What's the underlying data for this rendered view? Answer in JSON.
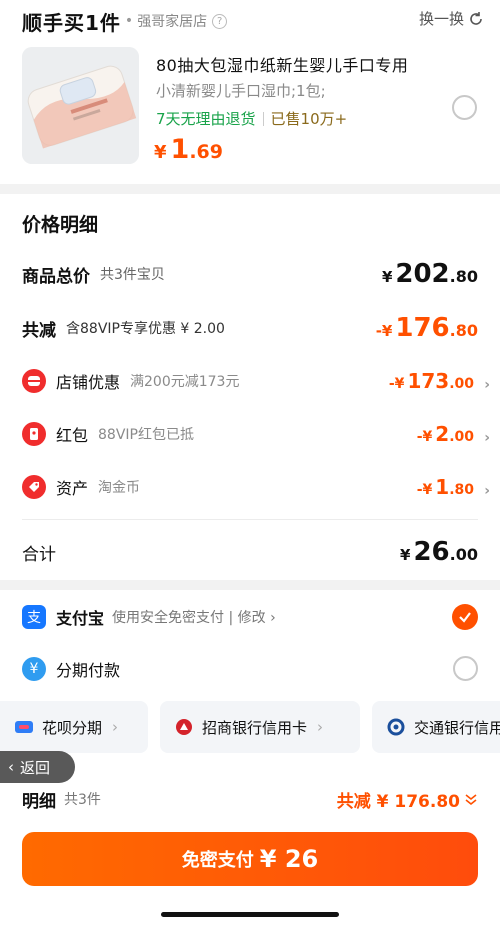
{
  "shop": {
    "title": "顺手买1件",
    "sep": "•",
    "name": "强哥家居店",
    "help": "?",
    "swap_label": "换一换"
  },
  "product": {
    "title": "80抽大包湿巾纸新生婴儿手口专用",
    "spec": "小清新婴儿手口湿巾;1包;",
    "tag_return": "7天无理由退货",
    "tag_sold": "已售10万+",
    "price": {
      "cur": "¥",
      "int": "1",
      "dec": ".69"
    }
  },
  "price_detail": {
    "title": "价格明细",
    "total": {
      "label": "商品总价",
      "sub": "共3件宝贝",
      "cur": "¥",
      "int": "202",
      "dec": ".80"
    },
    "reduce": {
      "label": "共减",
      "sub": "含88VIP专享优惠 ¥ 2.00",
      "cur": "-¥",
      "int": "176",
      "dec": ".80"
    },
    "items": [
      {
        "label": "店铺优惠",
        "sub": "满200元减173元",
        "cur": "-¥",
        "int": "173",
        "dec": ".00",
        "icon": "store-coupon-icon"
      },
      {
        "label": "红包",
        "sub": "88VIP红包已抵",
        "cur": "-¥",
        "int": "2",
        "dec": ".00",
        "icon": "red-packet-icon"
      },
      {
        "label": "资产",
        "sub": "淘金币",
        "cur": "-¥",
        "int": "1",
        "dec": ".80",
        "icon": "tag-coin-icon"
      }
    ],
    "sum": {
      "label": "合计",
      "cur": "¥",
      "int": "26",
      "dec": ".00"
    }
  },
  "payment": {
    "alipay": {
      "icon": "支",
      "label": "支付宝",
      "sub": "使用安全免密支付 | 修改 ›"
    },
    "installment": {
      "icon": "¥",
      "label": "分期付款"
    },
    "chips": [
      {
        "label": "花呗分期",
        "icon": "huabei-icon"
      },
      {
        "label": "招商银行信用卡",
        "icon": "cmb-bank-icon"
      },
      {
        "label": "交通银行信用",
        "icon": "bocom-bank-icon"
      }
    ]
  },
  "back": {
    "label": "返回"
  },
  "footer": {
    "detail_label": "明细",
    "detail_sub": "共3件",
    "reduce_label": "共减 ¥ 176.80",
    "pay_label": "免密支付",
    "pay_amount": "¥ 26"
  },
  "colors": {
    "accent": "#ff5000",
    "green": "#19a34a",
    "alipay": "#1677ff"
  }
}
